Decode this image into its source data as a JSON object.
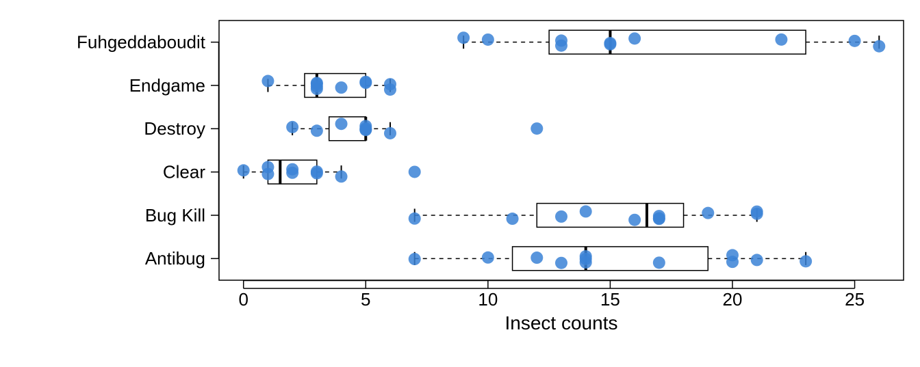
{
  "chart_data": {
    "type": "boxplot",
    "xlabel": "Insect counts",
    "ylabel": "",
    "xlim": [
      -1,
      27
    ],
    "x_ticks": [
      0,
      5,
      10,
      15,
      20,
      25
    ],
    "categories": [
      "Antibug",
      "Bug Kill",
      "Clear",
      "Destroy",
      "Endgame",
      "Fuhgeddaboudit"
    ],
    "series": [
      {
        "name": "Antibug",
        "box": {
          "whisker_low": 7,
          "q1": 11,
          "median": 14,
          "q3": 19,
          "whisker_high": 23
        },
        "points": [
          7,
          10,
          12,
          13,
          14,
          14,
          14,
          17,
          20,
          20,
          21,
          23
        ]
      },
      {
        "name": "Bug Kill",
        "box": {
          "whisker_low": 7,
          "q1": 12,
          "median": 16.5,
          "q3": 18,
          "whisker_high": 21
        },
        "points": [
          7,
          11,
          13,
          14,
          16,
          17,
          17,
          17,
          19,
          21,
          21
        ]
      },
      {
        "name": "Clear",
        "box": {
          "whisker_low": 0,
          "q1": 1,
          "median": 1.5,
          "q3": 3,
          "whisker_high": 4
        },
        "points": [
          0,
          1,
          1,
          2,
          2,
          3,
          3,
          4,
          7
        ]
      },
      {
        "name": "Destroy",
        "box": {
          "whisker_low": 2,
          "q1": 3.5,
          "median": 5,
          "q3": 5,
          "whisker_high": 6
        },
        "points": [
          2,
          3,
          4,
          5,
          5,
          5,
          5,
          6,
          12
        ]
      },
      {
        "name": "Endgame",
        "box": {
          "whisker_low": 1,
          "q1": 2.5,
          "median": 3,
          "q3": 5,
          "whisker_high": 6
        },
        "points": [
          1,
          3,
          3,
          3,
          3,
          4,
          5,
          5,
          6,
          6
        ]
      },
      {
        "name": "Fuhgeddaboudit",
        "box": {
          "whisker_low": 9,
          "q1": 12.5,
          "median": 15,
          "q3": 23,
          "whisker_high": 26
        },
        "points": [
          9,
          10,
          13,
          13,
          15,
          15,
          16,
          22,
          25,
          26
        ]
      }
    ],
    "colors": {
      "point_fill": "#3b82d6"
    }
  }
}
